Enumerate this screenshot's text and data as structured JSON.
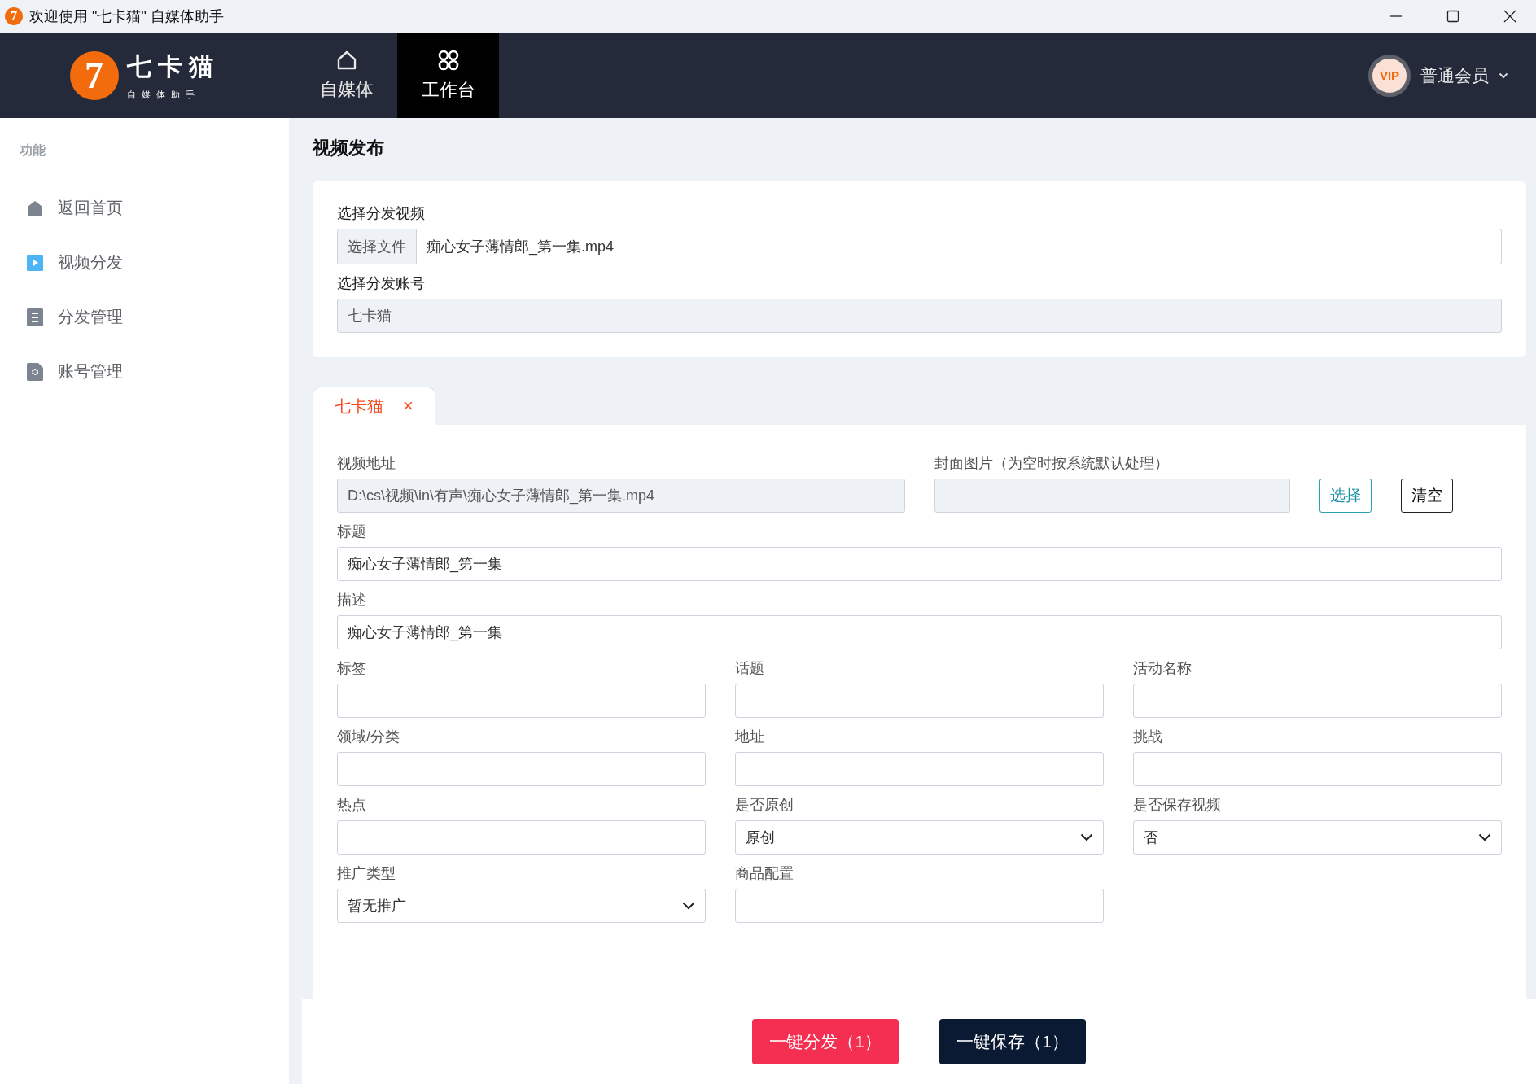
{
  "window": {
    "icon_text": "7",
    "title": "欢迎使用 \"七卡猫\" 自媒体助手"
  },
  "header": {
    "logo": {
      "mark": "7",
      "name": "七卡猫",
      "subtitle": "自 媒 体 助 手"
    },
    "nav": [
      {
        "label": "自媒体",
        "kind": "home",
        "selected": false
      },
      {
        "label": "工作台",
        "kind": "grid",
        "selected": true
      }
    ],
    "user": {
      "badge": "VIP",
      "label": "普通会员"
    }
  },
  "sidebar": {
    "section": "功能",
    "items": [
      {
        "label": "返回首页",
        "kind": "home"
      },
      {
        "label": "视频分发",
        "kind": "video"
      },
      {
        "label": "分发管理",
        "kind": "list"
      },
      {
        "label": "账号管理",
        "kind": "settings"
      }
    ]
  },
  "page_title": "视频发布",
  "source": {
    "file_label": "选择分发视频",
    "file_button": "选择文件",
    "file_value": "痴心女子薄情郎_第一集.mp4",
    "account_label": "选择分发账号",
    "account_value": "七卡猫",
    "account_disabled": true
  },
  "account_tabs": [
    {
      "label": "七卡猫",
      "close": "×",
      "selected": true
    }
  ],
  "form": {
    "video_path": {
      "label": "视频地址",
      "value": "D:\\cs\\视频\\in\\有声\\痴心女子薄情郎_第一集.mp4",
      "disabled": true
    },
    "cover": {
      "label": "封面图片（为空时按系统默认处理）",
      "disabled": true
    },
    "cover_buttons": [
      {
        "label": "选择",
        "kind": "accent"
      },
      {
        "label": "清空",
        "kind": "plain"
      }
    ],
    "wide_fields": [
      {
        "label": "标题",
        "value": "痴心女子薄情郎_第一集"
      },
      {
        "label": "描述",
        "value": "痴心女子薄情郎_第一集"
      }
    ],
    "fields": [
      {
        "label": "标签",
        "kind": "text"
      },
      {
        "label": "话题",
        "kind": "text"
      },
      {
        "label": "活动名称",
        "kind": "text"
      },
      {
        "label": "领域/分类",
        "kind": "text"
      },
      {
        "label": "地址",
        "kind": "text"
      },
      {
        "label": "挑战",
        "kind": "text"
      },
      {
        "label": "热点",
        "kind": "text"
      },
      {
        "label": "是否原创",
        "kind": "select",
        "value": "原创"
      },
      {
        "label": "是否保存视频",
        "kind": "select",
        "value": "否"
      },
      {
        "label": "推广类型",
        "kind": "select",
        "value": "暂无推广"
      },
      {
        "label": "商品配置",
        "kind": "text"
      }
    ]
  },
  "footer_buttons": [
    {
      "label": "一键分发（1）",
      "kind": "primary"
    },
    {
      "label": "一键保存（1）",
      "kind": "dark"
    }
  ]
}
